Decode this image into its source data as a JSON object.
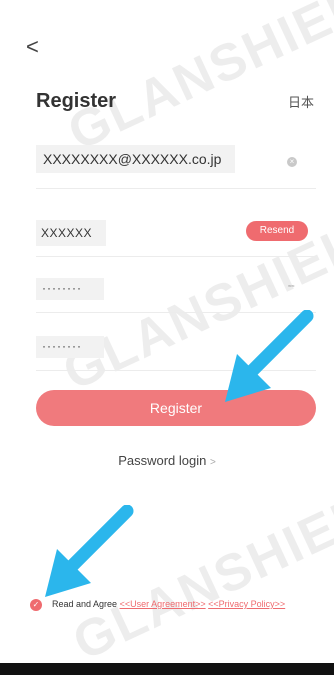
{
  "nav": {
    "back_glyph": "<"
  },
  "header": {
    "title": "Register",
    "language": "日本"
  },
  "form": {
    "email_value": "XXXXXXXX@XXXXXX.co.jp",
    "clear_glyph": "×",
    "code_value": "XXXXXX",
    "resend_label": "Resend",
    "password_value": "········",
    "eye_glyph": "≈≈",
    "confirm_password_value": "········",
    "register_label": "Register"
  },
  "links": {
    "password_login": "Password login",
    "chevron": ">"
  },
  "agreement": {
    "prefix": "Read and Agree ",
    "user_agreement": "<<User Agreement>>",
    "privacy_policy": "<<Privacy Policy>>",
    "checked": true
  },
  "colors": {
    "accent": "#ef6b6f",
    "button": "#f07a7d",
    "arrow": "#2bb6ec"
  },
  "icons": {
    "back": "chevron-left-icon",
    "clear": "clear-icon",
    "eye": "eye-icon",
    "check": "checkmark-icon",
    "arrow": "pointer-arrow-icon"
  }
}
